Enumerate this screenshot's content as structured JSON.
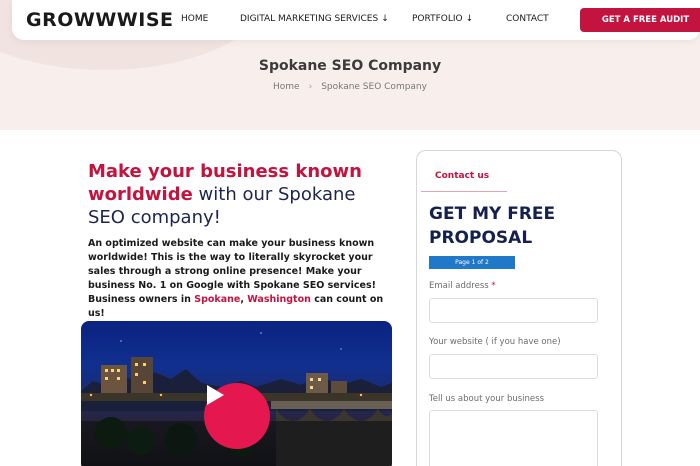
{
  "header": {
    "logo_text": "GROWWWISE",
    "nav": [
      {
        "label": "HOME"
      },
      {
        "label": "DIGITAL MARKETING SERVICES",
        "has_dropdown": true
      },
      {
        "label": "PORTFOLIO",
        "has_dropdown": true
      },
      {
        "label": "CONTACT"
      }
    ],
    "cta_label": "GET A FREE AUDIT"
  },
  "page": {
    "title": "Spokane SEO Company",
    "breadcrumb": [
      "Home",
      "Spokane SEO Company"
    ]
  },
  "main": {
    "headline_accent": "Make your business known worldwide",
    "headline_rest": " with our Spokane SEO company!",
    "intro_text": "An optimized website can make your business known worldwide! This is the way to literally skyrocket your sales through a strong online presence! Make your business No. 1 on Google with Spokane SEO services! Business owners in ",
    "intro_link_city": "Spokane",
    "intro_comma": ", ",
    "intro_link_state": "Washington",
    "intro_end": " can count on us!"
  },
  "form": {
    "tab_label": "Contact us",
    "title": "GET MY FREE PROPOSAL",
    "progress_text": "Page 1 of 2",
    "fields": [
      {
        "label": "Email address",
        "required_mark": "*"
      },
      {
        "label": "Your website ( if you have one)"
      },
      {
        "label": "Tell us about your business"
      }
    ]
  },
  "colors": {
    "accent": "#c3133f",
    "navy": "#15204e",
    "hero_bg": "#f8efec",
    "progress": "#1f78c8",
    "play_button": "#e4174f"
  }
}
